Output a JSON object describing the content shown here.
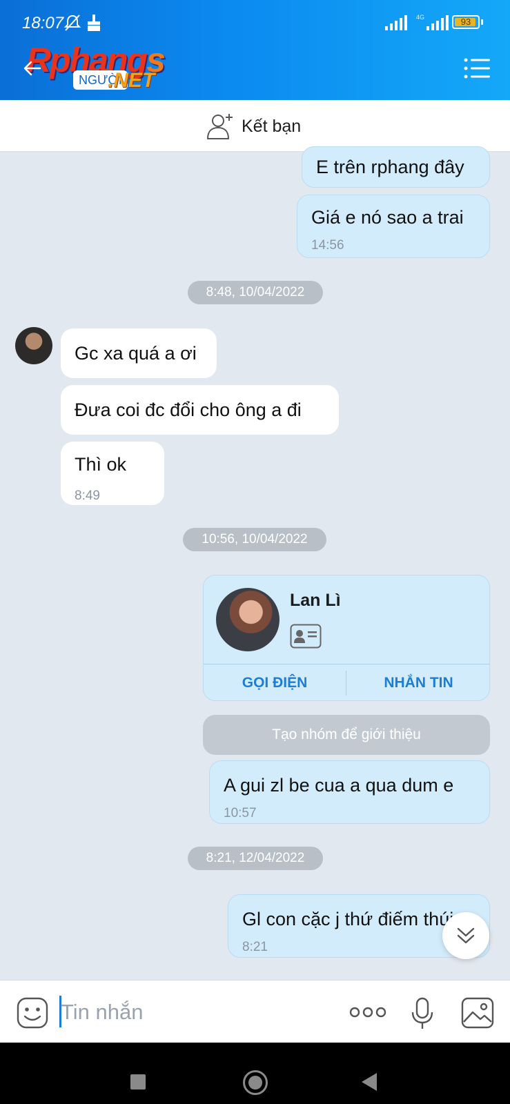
{
  "status_bar": {
    "time": "18:07",
    "network": "4G",
    "battery": "93",
    "battery_level": 0.93
  },
  "header": {
    "logo_main": "Rphang",
    "logo_tail": "s",
    "logo_sub": "NGƯỜI",
    "logo_net": ".NET",
    "back_icon": "arrow-left-icon",
    "menu_icon": "menu-icon"
  },
  "add_friend": {
    "label": "Kết bạn",
    "icon": "add-person-icon"
  },
  "messages": {
    "out_1": {
      "text": "E trên rphang đây"
    },
    "out_2": {
      "text": "Giá e nó sao a trai",
      "time": "14:56"
    },
    "date_1": "8:48, 10/04/2022",
    "in_1": {
      "text": "Gc xa quá a ơi"
    },
    "in_2": {
      "text": "Đưa coi đc đổi cho ông a đi"
    },
    "in_3": {
      "text": "Thì ok",
      "time": "8:49"
    },
    "date_2": "10:56, 10/04/2022",
    "contact_card": {
      "name": "Lan Lì",
      "call_label": "GỌI ĐIỆN",
      "message_label": "NHẮN TIN"
    },
    "system_action": "Tạo nhóm để giới thiệu",
    "out_3": {
      "text": "A gui zl be cua a qua dum e",
      "time": "10:57"
    },
    "date_3": "8:21, 12/04/2022",
    "out_4": {
      "text": "Gl con cặc j thứ điếm thúi",
      "time": "8:21"
    }
  },
  "composer": {
    "placeholder": "Tin nhắn",
    "value": ""
  },
  "colors": {
    "header_gradient_start": "#0a6fd6",
    "header_gradient_end": "#14a8f8",
    "outgoing_bubble": "#d3ecfc",
    "incoming_bubble": "#ffffff",
    "chat_background": "#e2e8ef",
    "accent": "#1a7ed6"
  }
}
